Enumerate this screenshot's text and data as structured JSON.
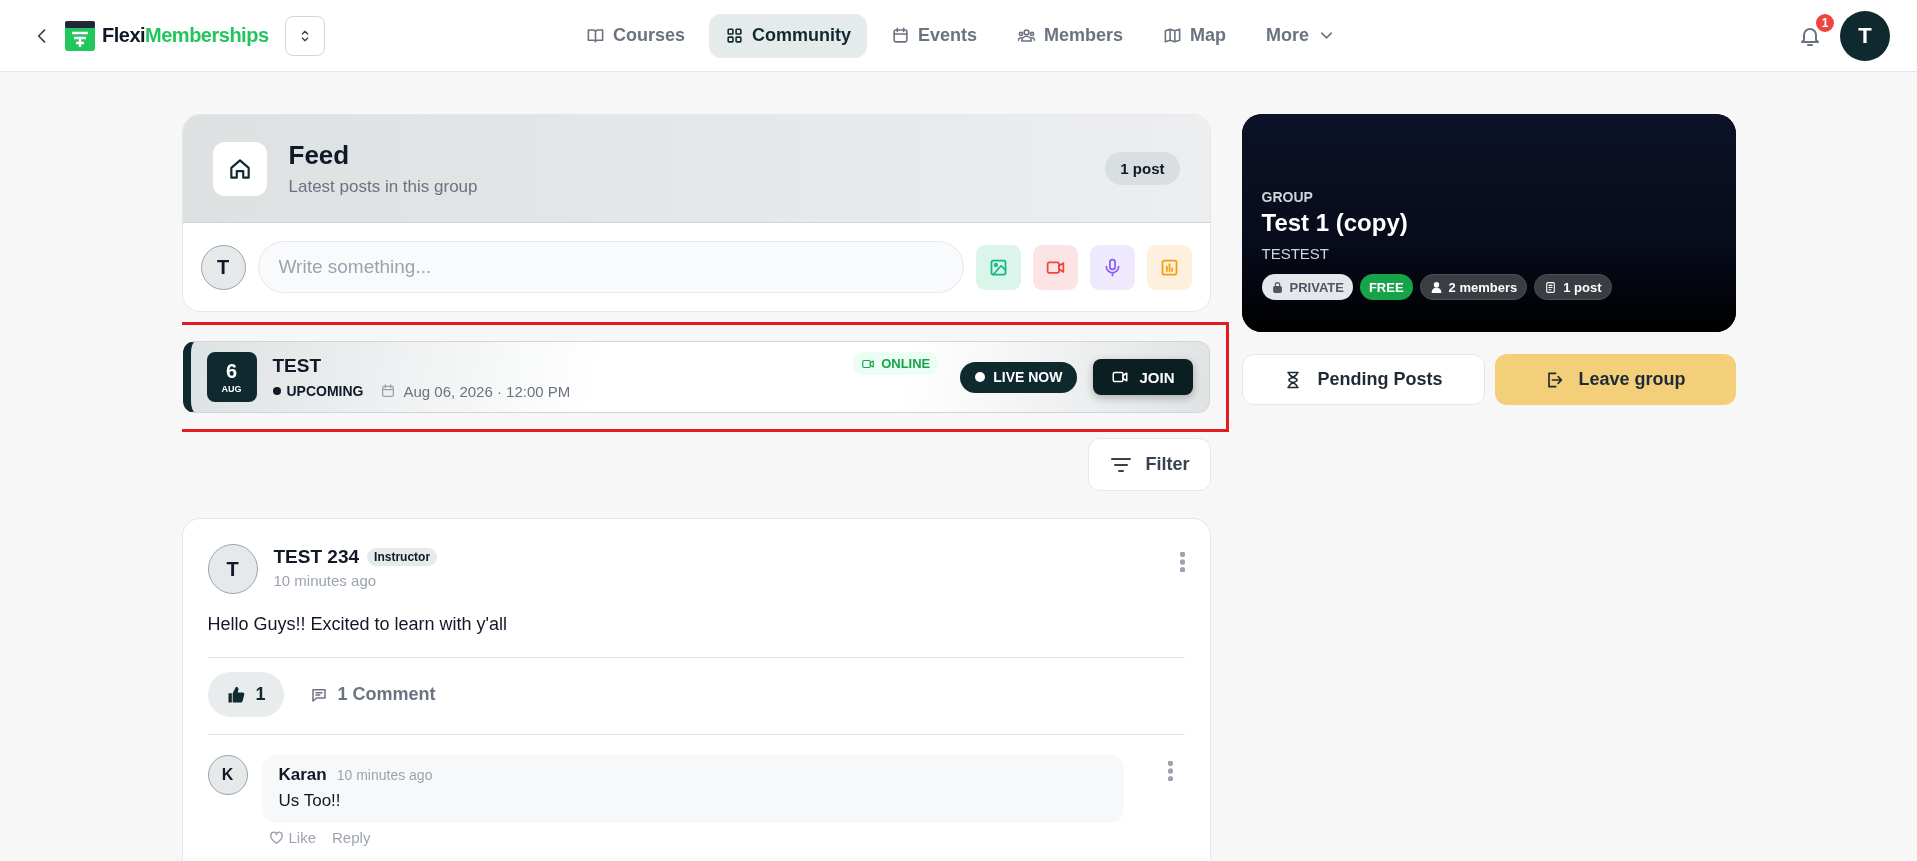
{
  "nav": {
    "brand": {
      "first": "Flexi",
      "second": "Memberships"
    },
    "items": [
      {
        "kind": "book",
        "label": "Courses",
        "selected": false
      },
      {
        "kind": "grid",
        "label": "Community",
        "selected": true
      },
      {
        "kind": "calendar",
        "label": "Events",
        "selected": false
      },
      {
        "kind": "people",
        "label": "Members",
        "selected": false
      },
      {
        "kind": "map",
        "label": "Map",
        "selected": false
      }
    ],
    "more": "More",
    "notification_count": "1",
    "avatar": "T"
  },
  "feed": {
    "title": "Feed",
    "subtitle": "Latest posts in this group",
    "count": "1 post",
    "composer": {
      "avatar": "T",
      "placeholder": "Write something...",
      "tools": [
        {
          "kind": "image"
        },
        {
          "kind": "video"
        },
        {
          "kind": "mic"
        },
        {
          "kind": "poll"
        }
      ]
    }
  },
  "event": {
    "highlighted": true,
    "day": "6",
    "month": "AUG",
    "title": "TEST",
    "status": "UPCOMING",
    "datetime": "Aug 06, 2026 · 12:00 PM",
    "mode": "ONLINE",
    "live": "LIVE NOW",
    "join": "JOIN"
  },
  "filter": "Filter",
  "post": {
    "avatar": "T",
    "author": "TEST 234",
    "role": "Instructor",
    "time": "10 minutes ago",
    "body": "Hello Guys!! Excited to learn with y'all",
    "likes": "1",
    "liked": true,
    "comments_label": "1 Comment",
    "comments": [
      {
        "avatar": "K",
        "author": "Karan",
        "time": "10 minutes ago",
        "body": "Us Too!!",
        "like": "Like",
        "reply": "Reply"
      }
    ]
  },
  "group": {
    "label": "GROUP",
    "name": "Test 1 (copy)",
    "description": "TESTEST",
    "badges": [
      {
        "kind": "private",
        "label": "PRIVATE"
      },
      {
        "kind": "free",
        "label": "FREE"
      },
      {
        "kind": "members",
        "label": "2 members"
      },
      {
        "kind": "posts",
        "label": "1 post"
      }
    ],
    "pending": "Pending Posts",
    "leave": "Leave group"
  }
}
